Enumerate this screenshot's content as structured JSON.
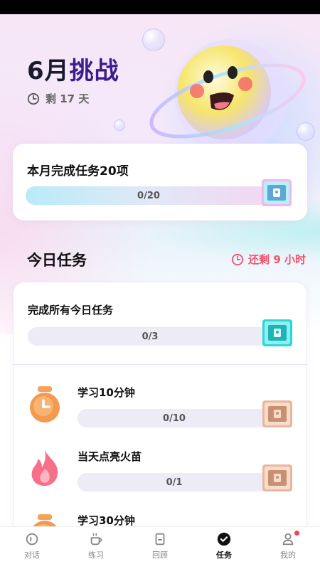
{
  "header": {
    "title_part1": "6月",
    "title_part2": "挑战",
    "remaining": "剩 17 天"
  },
  "monthly": {
    "title": "本月完成任务20项",
    "progress_text": "0/20",
    "progress_value": 0
  },
  "today": {
    "heading": "今日任务",
    "time_left": "还剩 9 小时",
    "all_tasks": {
      "title": "完成所有今日任务",
      "progress_text": "0/3",
      "progress_value": 0
    },
    "tasks": [
      {
        "title": "学习10分钟",
        "progress_text": "0/10",
        "progress_value": 0,
        "icon": "clock-icon"
      },
      {
        "title": "当天点亮火苗",
        "progress_text": "0/1",
        "progress_value": 0,
        "icon": "flame-icon"
      },
      {
        "title": "学习30分钟",
        "progress_text": "",
        "progress_value": 0,
        "icon": "clock-icon"
      }
    ]
  },
  "tabs": [
    {
      "label": "对话",
      "icon": "chat-icon",
      "active": false
    },
    {
      "label": "练习",
      "icon": "coffee-icon",
      "active": false
    },
    {
      "label": "回顾",
      "icon": "book-icon",
      "active": false
    },
    {
      "label": "任务",
      "icon": "check-circle-icon",
      "active": true
    },
    {
      "label": "我的",
      "icon": "profile-icon",
      "active": false,
      "badge": true
    }
  ],
  "colors": {
    "accent_red": "#f4506a",
    "title_purple": "#3a1c8c",
    "chest_pink": "#f2b6ea",
    "chest_teal": "#2fd6d8",
    "chest_tan": "#e8b89e"
  }
}
